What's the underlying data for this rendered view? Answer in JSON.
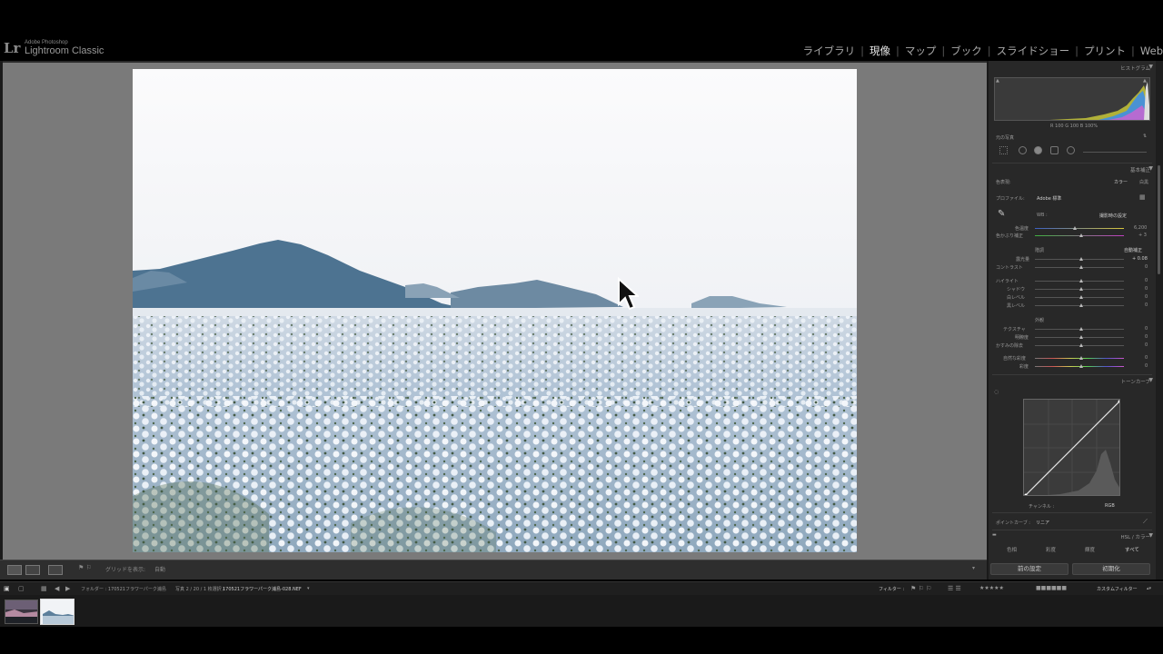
{
  "app": {
    "brand_small": "Adobe Photoshop",
    "brand_big": "Lightroom Classic",
    "logo": "Lr"
  },
  "modules": [
    "ライブラリ",
    "現像",
    "マップ",
    "ブック",
    "スライドショー",
    "プリント",
    "Web"
  ],
  "active_module": "現像",
  "toolbar": {
    "grid_label": "グリッドを表示:",
    "grid_value": "自動"
  },
  "filmstrip_bar": {
    "path_prefix": "フォルダー : 170521フラワーパーク浦島",
    "photo_count": "写真 2 / 20 / 1 枚選択 /",
    "filename": "170521フラワーパーク浦島-028.NEF",
    "filter_label": "フィルター :",
    "filter_value": "カスタムフィルター"
  },
  "histogram": {
    "title": "ヒストグラム",
    "readout": "R   100   G   100   B   100%",
    "original_photo": "元の写真"
  },
  "basic": {
    "title": "基本補正",
    "treatment_label": "色表現:",
    "treatment_color": "カラー",
    "treatment_bw": "白黒",
    "profile_label": "プロファイル:",
    "profile_value": "Adobe 標準",
    "wb_label": "WB :",
    "wb_value": "撮影時の設定",
    "temp_label": "色温度",
    "temp_value": "6,200",
    "tint_label": "色かぶり補正",
    "tint_value": "+ 3",
    "tone_label": "階調",
    "auto_label": "自動補正",
    "exposure_label": "露光量",
    "exposure_value": "+ 0.08",
    "contrast_label": "コントラスト",
    "contrast_value": "0",
    "highlights_label": "ハイライト",
    "highlights_value": "0",
    "shadows_label": "シャドウ",
    "shadows_value": "0",
    "whites_label": "白レベル",
    "whites_value": "0",
    "blacks_label": "黒レベル",
    "blacks_value": "0",
    "presence_label": "外観",
    "texture_label": "テクスチャ",
    "texture_value": "0",
    "clarity_label": "明瞭度",
    "clarity_value": "0",
    "dehaze_label": "かすみの除去",
    "dehaze_value": "0",
    "vibrance_label": "自然な彩度",
    "vibrance_value": "0",
    "saturation_label": "彩度",
    "saturation_value": "0"
  },
  "tone_curve": {
    "title": "トーンカーブ",
    "channel_label": "チャンネル :",
    "channel_value": "RGB",
    "point_curve_label": "ポイントカーブ :",
    "point_curve_value": "リニア"
  },
  "hsl": {
    "title": "HSL / カラー",
    "tabs": [
      "色相",
      "彩度",
      "輝度",
      "すべて"
    ]
  },
  "buttons": {
    "previous": "前の設定",
    "reset": "初期化"
  },
  "colors": {
    "panel_bg": "#282828",
    "work_bg": "#7a7a7a",
    "accent": "#e6e6e6"
  }
}
